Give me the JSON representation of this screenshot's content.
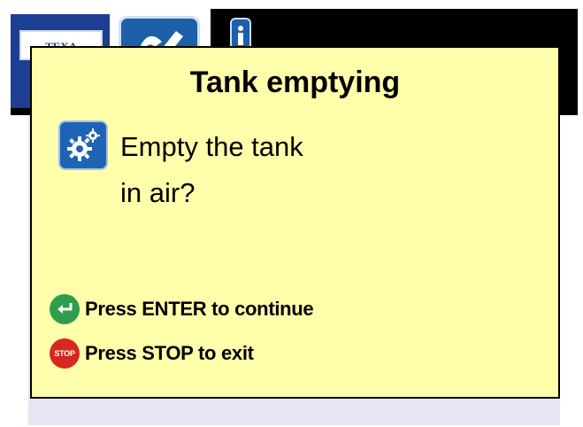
{
  "header": {
    "logo_text": "TEXA"
  },
  "dialog": {
    "title": "Tank emptying",
    "question_line1": "Empty the tank",
    "question_line2": "in air?",
    "enter_action": "Press ENTER to continue",
    "stop_action": "Press STOP to exit",
    "stop_badge": "STOP"
  },
  "colors": {
    "dialog_bg": "#fffeaa",
    "accent_blue": "#1e63b5",
    "enter_green": "#2f9c4e",
    "stop_red": "#d7281f"
  }
}
